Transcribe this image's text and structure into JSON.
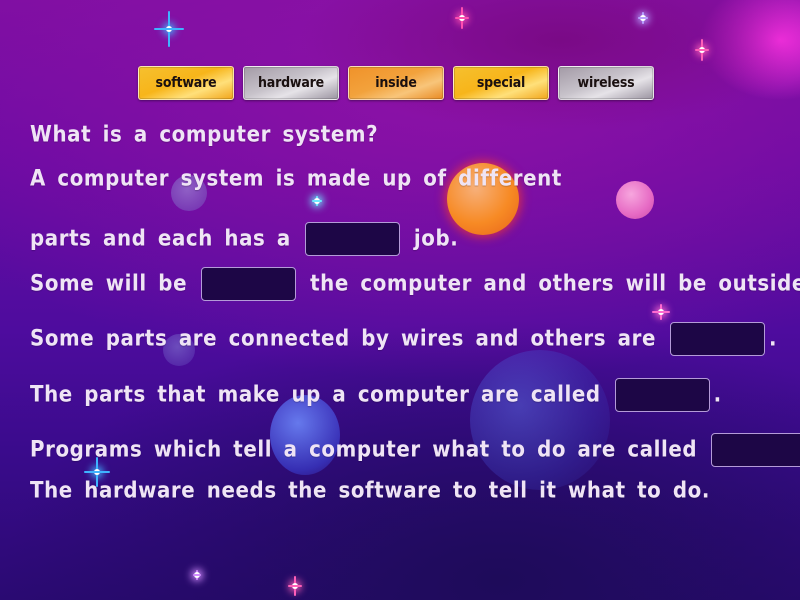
{
  "activity": {
    "word_bank": [
      {
        "label": "software",
        "style": "gold"
      },
      {
        "label": "hardware",
        "style": "silver"
      },
      {
        "label": "inside",
        "style": "orange"
      },
      {
        "label": "special",
        "style": "gold"
      },
      {
        "label": "wireless",
        "style": "silver"
      }
    ],
    "lines": [
      {
        "before": "What is a computer system?",
        "blank": false,
        "after": ""
      },
      {
        "before": "A computer system is made up of different",
        "blank": false,
        "after": ""
      },
      {
        "before": "parts and each has a",
        "blank": true,
        "blank_value": "",
        "after": "job."
      },
      {
        "before": "Some will be",
        "blank": true,
        "blank_value": "",
        "after": "the computer and others will be outside."
      },
      {
        "before": "Some parts are connected by wires and others are",
        "blank": true,
        "blank_value": "",
        "after": "."
      },
      {
        "before": "The parts that make up a computer are called",
        "blank": true,
        "blank_value": "",
        "after": "."
      },
      {
        "before": "Programs which tell a computer what to do are called",
        "blank": true,
        "blank_value": "",
        "after": "."
      },
      {
        "before": "The hardware needs the software to tell it what to do.",
        "blank": false,
        "after": ""
      }
    ]
  },
  "theme": {
    "text_color": "#efe4f5",
    "blank_fill": "#1d0646",
    "blank_border": "#b49bd8"
  }
}
